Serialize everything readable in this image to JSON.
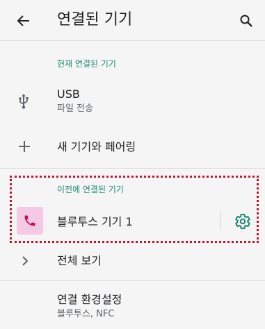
{
  "toolbar": {
    "title": "연결된 기기",
    "back_icon": "arrow-back-icon",
    "search_icon": "search-icon"
  },
  "current": {
    "header": "현재 연결된 기기",
    "usb": {
      "title": "USB",
      "subtitle": "파일 전송",
      "icon": "usb-icon"
    }
  },
  "pair": {
    "label": "새 기기와 페어링",
    "icon": "add-icon"
  },
  "previous": {
    "header": "이전에 연결된 기기",
    "device": {
      "name": "블루투스 기기 1",
      "icon": "phone-icon",
      "settings_icon": "gear-icon"
    }
  },
  "see_all": {
    "label": "전체 보기",
    "icon": "chevron-right-icon"
  },
  "prefs": {
    "title": "연결 환경설정",
    "subtitle": "블루투스, NFC"
  },
  "colors": {
    "accent": "#1a8a72",
    "tile": "#f5c9e6",
    "highlight": "#c8102e",
    "phone": "#c2185b"
  }
}
